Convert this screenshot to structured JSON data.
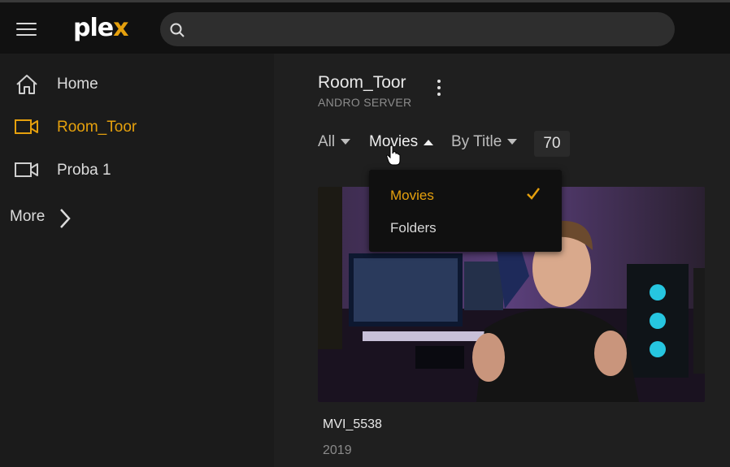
{
  "app": {
    "logo_main": "ple",
    "logo_x": "x",
    "accent": "#e5a00d"
  },
  "search": {
    "placeholder": ""
  },
  "sidebar": {
    "items": [
      {
        "label": "Home",
        "icon": "home-icon"
      },
      {
        "label": "Room_Toor",
        "icon": "video-camera-icon",
        "active": true
      },
      {
        "label": "Proba 1",
        "icon": "video-camera-icon"
      }
    ],
    "more_label": "More"
  },
  "library": {
    "title": "Room_Toor",
    "server": "ANDRO SERVER",
    "filter_all": "All",
    "filter_type": "Movies",
    "filter_sort": "By Title",
    "count": "70"
  },
  "type_dropdown": {
    "options": [
      {
        "label": "Movies",
        "selected": true
      },
      {
        "label": "Folders",
        "selected": false
      }
    ]
  },
  "items": [
    {
      "title": "MVI_5538",
      "year": "2019"
    }
  ]
}
